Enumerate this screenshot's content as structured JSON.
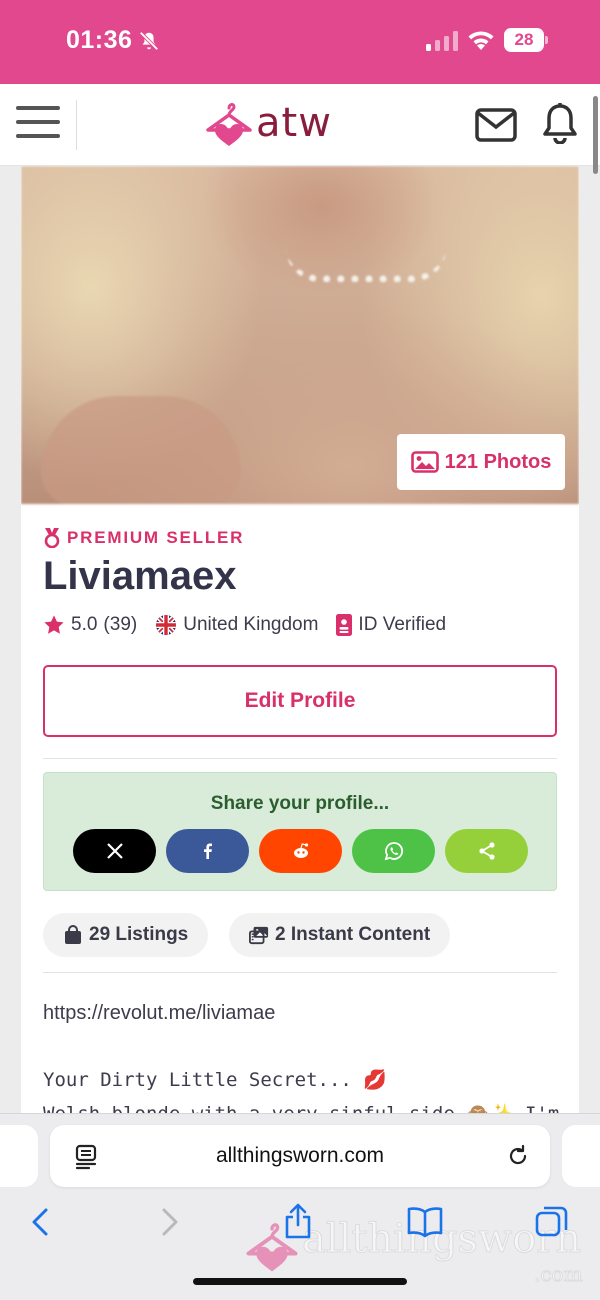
{
  "status_bar": {
    "time": "01:36",
    "battery": "28"
  },
  "header": {
    "logo_text": "atw"
  },
  "profile": {
    "photos_count_label": "121 Photos",
    "badge": "PREMIUM SELLER",
    "name": "Liviamaex",
    "rating": "5.0",
    "reviews": "(39)",
    "country": "United Kingdom",
    "verification": "ID Verified",
    "edit_button": "Edit Profile"
  },
  "share": {
    "title": "Share your profile...",
    "buttons": [
      {
        "network": "x",
        "color": "#000000"
      },
      {
        "network": "facebook",
        "color": "#3b5998"
      },
      {
        "network": "reddit",
        "color": "#ff4500"
      },
      {
        "network": "whatsapp",
        "color": "#4dc247"
      },
      {
        "network": "share",
        "color": "#95d03a"
      }
    ]
  },
  "stats": {
    "listings": "29 Listings",
    "instant_content": "2 Instant Content"
  },
  "bio": {
    "url": "https://revolut.me/liviamae",
    "line1": "Your Dirty Little Secret... 💋",
    "line2": "Welsh blonde with a very sinful side 🙈✨ I'm"
  },
  "browser": {
    "url": "allthingsworn.com"
  },
  "watermark": {
    "text": "allthingsworn",
    "sub": ".com"
  },
  "colors": {
    "brand_pink": "#e2488d",
    "accent": "#d9306b",
    "logo_maroon": "#8a1c3d",
    "share_bg": "#d9ecda",
    "share_title": "#2b5e2f"
  }
}
